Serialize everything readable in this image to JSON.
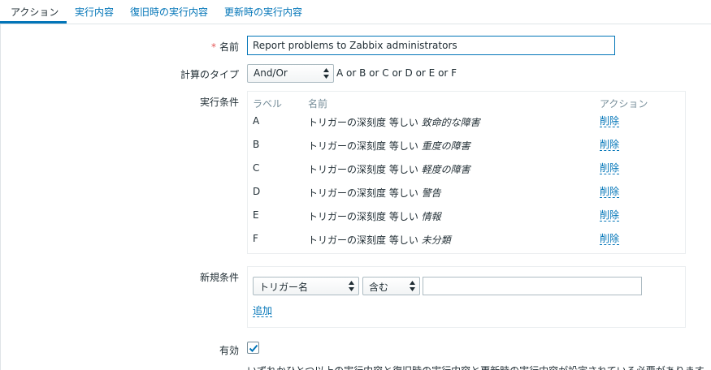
{
  "tabs": [
    {
      "label": "アクション",
      "active": true
    },
    {
      "label": "実行内容"
    },
    {
      "label": "復旧時の実行内容"
    },
    {
      "label": "更新時の実行内容"
    }
  ],
  "form": {
    "name_label": "名前",
    "required_mark": "*",
    "name_value": "Report problems to Zabbix administrators",
    "calc_type_label": "計算のタイプ",
    "calc_type_value": "And/Or",
    "formula": "A or B or C or D or E or F",
    "conditions_label": "実行条件",
    "conditions_headers": {
      "label": "ラベル",
      "name": "名前",
      "action": "アクション"
    },
    "conditions": [
      {
        "label": "A",
        "text": "トリガーの深刻度 等しい ",
        "value": "致命的な障害",
        "action": "削除"
      },
      {
        "label": "B",
        "text": "トリガーの深刻度 等しい ",
        "value": "重度の障害",
        "action": "削除"
      },
      {
        "label": "C",
        "text": "トリガーの深刻度 等しい ",
        "value": "軽度の障害",
        "action": "削除"
      },
      {
        "label": "D",
        "text": "トリガーの深刻度 等しい ",
        "value": "警告",
        "action": "削除"
      },
      {
        "label": "E",
        "text": "トリガーの深刻度 等しい ",
        "value": "情報",
        "action": "削除"
      },
      {
        "label": "F",
        "text": "トリガーの深刻度 等しい ",
        "value": "未分類",
        "action": "削除"
      }
    ],
    "new_condition_label": "新規条件",
    "new_condition_type": "トリガー名",
    "new_condition_operator": "含む",
    "new_condition_value": "",
    "add_link": "追加",
    "enabled_label": "有効",
    "enabled": true,
    "bottom_note": "いずれかひとつ以上の実行内容と復旧時の実行内容と更新時の実行内容が設定されている必要があります。"
  },
  "colors": {
    "accent": "#0275b8",
    "required": "#e45959",
    "muted": "#768d99"
  }
}
